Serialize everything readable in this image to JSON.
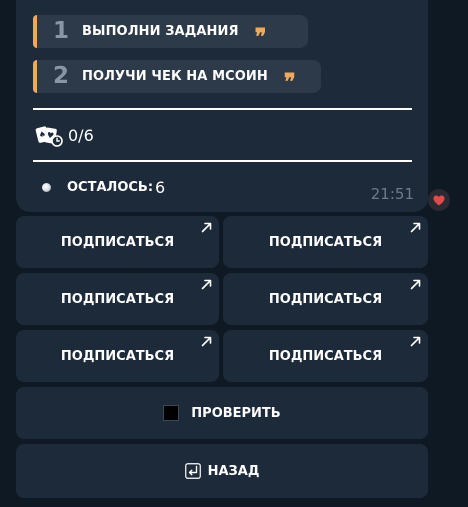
{
  "message": {
    "steps": [
      {
        "number": "1",
        "text": "ВЫПОЛНИ ЗАДАНИЯ",
        "icon": "quote-icon",
        "icon_glyph": "❞"
      },
      {
        "number": "2",
        "text": "ПОЛУЧИ ЧЕК НА MCOИН",
        "icon": "quote-icon",
        "icon_glyph": "❞"
      }
    ],
    "progress": {
      "icon": "cards-icon",
      "value": "0/6"
    },
    "remaining": {
      "icon": "dot-icon",
      "label": "ОСТАЛОСЬ:",
      "value": "6"
    },
    "time": "21:51",
    "reaction": {
      "icon": "heart-icon",
      "color": "#e24a4a"
    }
  },
  "keyboard": {
    "subscribe_buttons": [
      {
        "label": "ПОДПИСАТЬСЯ",
        "icon": "external-link-arrow-icon"
      },
      {
        "label": "ПОДПИСАТЬСЯ",
        "icon": "external-link-arrow-icon"
      },
      {
        "label": "ПОДПИСАТЬСЯ",
        "icon": "external-link-arrow-icon"
      },
      {
        "label": "ПОДПИСАТЬСЯ",
        "icon": "external-link-arrow-icon"
      },
      {
        "label": "ПОДПИСАТЬСЯ",
        "icon": "external-link-arrow-icon"
      },
      {
        "label": "ПОДПИСАТЬСЯ",
        "icon": "external-link-arrow-icon"
      }
    ],
    "check_button": {
      "label": "ПРОВЕРИТЬ",
      "icon": "black-square-icon"
    },
    "back_button": {
      "label": "НАЗАД",
      "icon": "return-arrow-icon",
      "icon_glyph": "⏎"
    }
  },
  "colors": {
    "background": "#0f1923",
    "bubble": "#1c2a39",
    "step_block": "#2c3a4a",
    "accent": "#f0a95a",
    "muted_text": "#6d7c8c"
  }
}
